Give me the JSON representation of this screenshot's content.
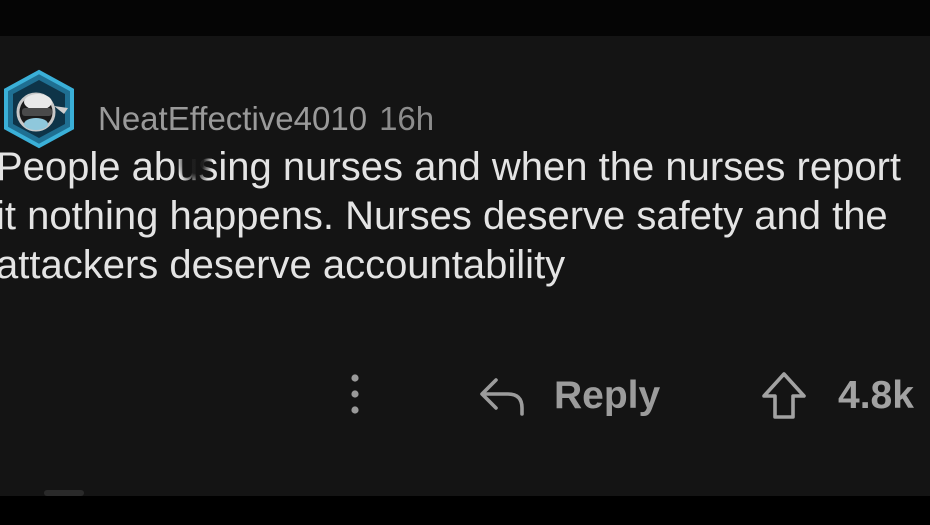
{
  "comment": {
    "author": "NeatEffective4010",
    "time": "16h",
    "body_lines": [
      "People abusing nurses and when the nurses report",
      "it nothing happens. Nurses deserve safety and the",
      "attackers deserve accountability"
    ]
  },
  "actions": {
    "more_icon": "more-vertical-icon",
    "reply_icon": "reply-arrow-icon",
    "reply_label": "Reply",
    "upvote_icon": "upvote-arrow-icon",
    "vote_count": "4.8k"
  },
  "avatar": {
    "icon": "avatar-icon",
    "ring_color": "#3ab0d8"
  }
}
